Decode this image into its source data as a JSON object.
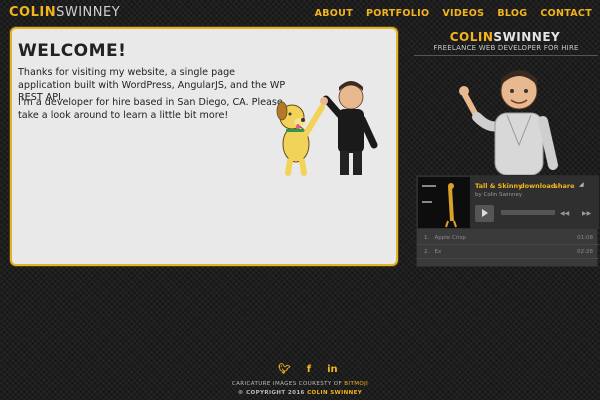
{
  "header": {
    "logo_part1": "COLIN",
    "logo_part2": "SWINNEY",
    "nav": [
      "ABOUT",
      "PORTFOLIO",
      "VIDEOS",
      "BLOG",
      "CONTACT"
    ]
  },
  "main": {
    "heading": "WELCOME!",
    "para1": "Thanks for visiting my website, a single page application built with WordPress, AngularJS, and the WP REST API.",
    "para2": "I'm a developer for hire based in San Diego, CA. Please take a look around to learn a little bit more!"
  },
  "sidebar": {
    "logo_part1": "COLIN",
    "logo_part2": "SWINNEY",
    "tagline": "FREELANCE WEB DEVELOPER FOR HIRE",
    "player": {
      "title": "Tall & Skinny",
      "download": "download",
      "share": "share",
      "artist": "by Colin Swinney",
      "tracks": [
        {
          "num": "1.",
          "name": "Apple Crisp",
          "dur": "01:08"
        },
        {
          "num": "2.",
          "name": "Ex",
          "dur": "02:28"
        }
      ]
    }
  },
  "footer": {
    "social_icons": [
      "twitter-icon",
      "facebook-icon",
      "linkedin-icon"
    ],
    "credit_prefix": "CARICATURE IMAGES COURESTY OF",
    "credit_link": "BITMOJI",
    "copyright_prefix": "© COPYRIGHT 2016",
    "copyright_name": "COLIN SWINNEY"
  },
  "colors": {
    "accent": "#f3b51c",
    "panel_bg": "#e9e9e9",
    "page_bg": "#1d1d1d"
  }
}
